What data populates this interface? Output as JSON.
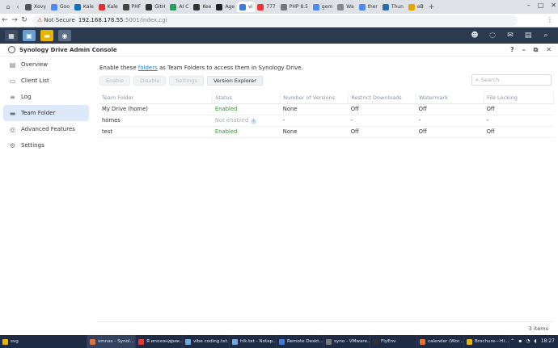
{
  "browser": {
    "tabs": [
      {
        "label": "Xovy",
        "color": "#555555"
      },
      {
        "label": "Goo",
        "color": "#4c8bf5"
      },
      {
        "label": "Kale",
        "color": "#0b72c4"
      },
      {
        "label": "Kale",
        "color": "#d33"
      },
      {
        "label": "PHF",
        "color": "#444"
      },
      {
        "label": "GitH",
        "color": "#333"
      },
      {
        "label": "AI C",
        "color": "#2b9a5e"
      },
      {
        "label": "Kee",
        "color": "#333"
      },
      {
        "label": "Age",
        "color": "#222"
      },
      {
        "label": "vi",
        "color": "#3d7bd9",
        "active": true
      },
      {
        "label": "777",
        "color": "#e33"
      },
      {
        "label": "PHP 8.5",
        "color": "#777"
      },
      {
        "label": "gem",
        "color": "#4c8bf5"
      },
      {
        "label": "Wa",
        "color": "#888"
      },
      {
        "label": "ther",
        "color": "#4c8bf5"
      },
      {
        "label": "Thun",
        "color": "#2b6cb0"
      },
      {
        "label": "eB",
        "color": "#e8a400"
      }
    ],
    "security": "Not Secure",
    "host": "192.168.178.55",
    "path": ":5001/index.cgi"
  },
  "app": {
    "title": "Synology Drive Admin Console",
    "sidebar": [
      {
        "label": "Overview",
        "icon": "overview-icon",
        "glyph": "▤"
      },
      {
        "label": "Client List",
        "icon": "client-list-icon",
        "glyph": "▭"
      },
      {
        "label": "Log",
        "icon": "log-icon",
        "glyph": "≡"
      },
      {
        "label": "Team Folder",
        "icon": "folder-icon",
        "glyph": "▬",
        "active": true
      },
      {
        "label": "Advanced Features",
        "icon": "advanced-icon",
        "glyph": "◎"
      },
      {
        "label": "Settings",
        "icon": "gear-icon",
        "glyph": "⚙"
      }
    ],
    "description_pre": "Enable these",
    "description_link": "folders",
    "description_post": "as Team Folders to access them in Synology Drive.",
    "toolbar": {
      "enable": "Enable",
      "disable": "Disable",
      "settings": "Settings",
      "version_explorer": "Version Explorer"
    },
    "search_placeholder": "Search",
    "columns": [
      "Team Folder",
      "Status",
      "Number of Versions",
      "Restrict Downloads",
      "Watermark",
      "File Locking"
    ],
    "rows": [
      {
        "folder": "My Drive (home)",
        "status": "Enabled",
        "versions": "None",
        "restrict": "Off",
        "watermark": "Off",
        "locking": "Off"
      },
      {
        "folder": "homes",
        "status": "Not enabled",
        "versions": "-",
        "restrict": "-",
        "watermark": "-",
        "locking": "-"
      },
      {
        "folder": "test",
        "status": "Enabled",
        "versions": "None",
        "restrict": "Off",
        "watermark": "Off",
        "locking": "Off"
      }
    ],
    "item_count": "3 items"
  },
  "taskbar": {
    "items": [
      {
        "label": "svg",
        "color": "#e8b400"
      },
      {
        "label": "vmnas - Synol...",
        "color": "#e8702a",
        "active": true
      },
      {
        "label": "Я ипохондрик...",
        "color": "#e33"
      },
      {
        "label": "vibe coding.txt...",
        "color": "#6fa8dc"
      },
      {
        "label": "hik.txt - Notep...",
        "color": "#6fa8dc"
      },
      {
        "label": "Remote Deskt...",
        "color": "#3d7bd9"
      },
      {
        "label": "syno - VMware...",
        "color": "#777"
      },
      {
        "label": "FlyEnv",
        "color": "#333"
      },
      {
        "label": "calender (Wor...",
        "color": "#e8702a"
      },
      {
        "label": "Brochure---Hi...",
        "color": "#e8b400"
      }
    ],
    "clock": "18:27"
  }
}
